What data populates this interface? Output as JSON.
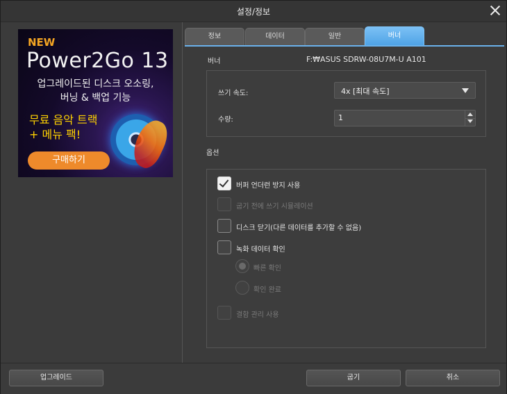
{
  "window": {
    "title": "설정/정보"
  },
  "ad": {
    "badge": "NEW",
    "product": "Power2Go 13",
    "line1": "업그레이드된 디스크 오소링,",
    "line2": "버닝 & 백업 기능",
    "promo1": "무료 음악 트랙",
    "promo2": "+ 메뉴 팩!",
    "buy_label": "구매하기"
  },
  "tabs": [
    {
      "label": "정보"
    },
    {
      "label": "데이터"
    },
    {
      "label": "일반"
    },
    {
      "label": "버너",
      "active": true
    }
  ],
  "burner": {
    "label": "버너",
    "drive": "F:₩ASUS SDRW-08U7M-U A101",
    "speed_label": "쓰기 속도:",
    "speed_value": "4x [최대 속도]",
    "quantity_label": "수량:",
    "quantity_value": "1"
  },
  "options": {
    "section_label": "옵션",
    "buffer_underrun": {
      "label": "버퍼 언더런 방지 사용",
      "checked": true,
      "enabled": true
    },
    "simulate": {
      "label": "굽기 전에 쓰기 시뮬레이션",
      "checked": false,
      "enabled": false
    },
    "close_disc": {
      "label": "디스크 닫기(다른 데이터를 추가할 수 없음)",
      "checked": false,
      "enabled": true
    },
    "verify": {
      "label": "녹화 데이터 확인",
      "checked": false,
      "enabled": true
    },
    "quick_verify": {
      "label": "빠른 확인",
      "selected": true,
      "enabled": false
    },
    "full_verify": {
      "label": "확인 완료",
      "selected": false,
      "enabled": false
    },
    "defect_mgmt": {
      "label": "결함 관리 사용",
      "checked": false,
      "enabled": false
    }
  },
  "footer": {
    "upgrade_label": "업그레이드",
    "burn_label": "굽기",
    "cancel_label": "취소"
  },
  "colors": {
    "accent": "#4fa3e6",
    "buy_button": "#ee8a2b",
    "promo": "#ffd200"
  }
}
